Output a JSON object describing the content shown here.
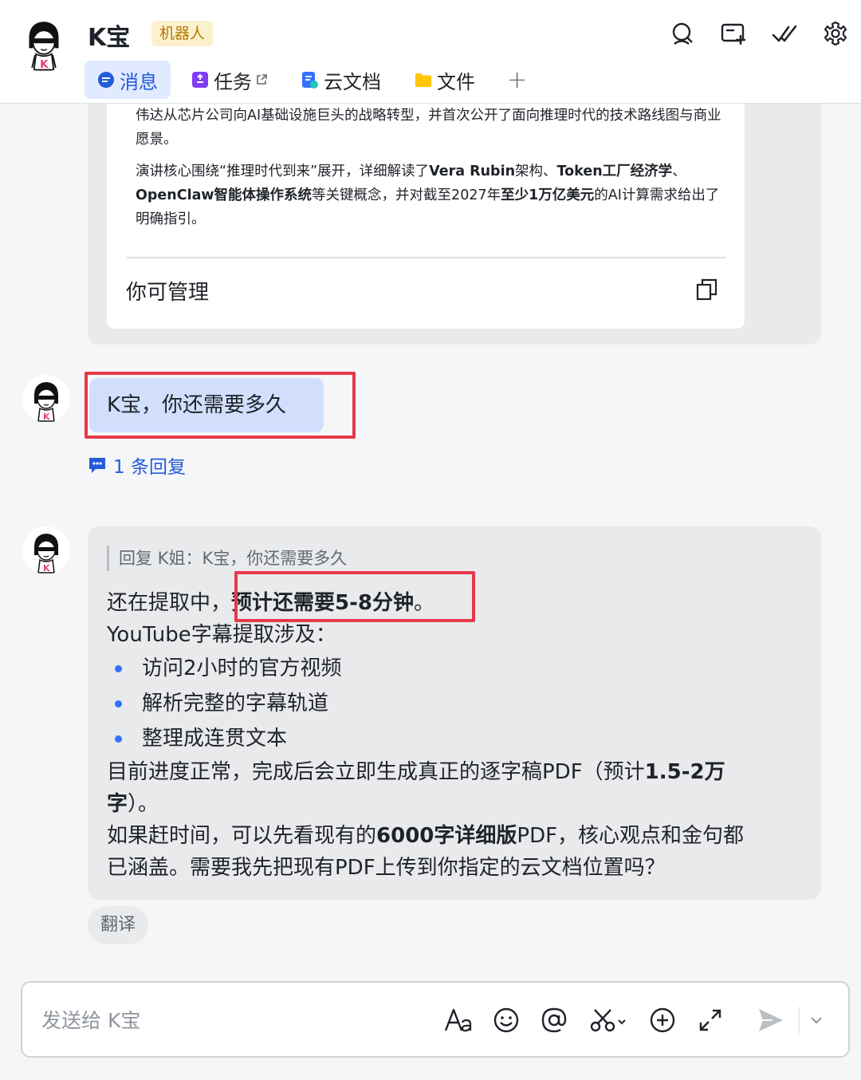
{
  "header": {
    "title": "K宝",
    "badge": "机器人",
    "icons": [
      "search-icon",
      "add-card-icon",
      "checkmark-icon",
      "gear-icon"
    ],
    "tabs": [
      {
        "label": "消息",
        "icon": "chat-bubble-icon",
        "active": true
      },
      {
        "label": "任务",
        "icon": "task-icon",
        "external": true
      },
      {
        "label": "云文档",
        "icon": "cloud-doc-icon"
      },
      {
        "label": "文件",
        "icon": "folder-icon"
      }
    ],
    "add_tab": "+"
  },
  "card": {
    "para1": "伟达从芯片公司向AI基础设施巨头的战略转型，并首次公开了面向推理时代的技术路线图与商业愿景。",
    "para2_parts": [
      "演讲核心围绕“推理时代到来”展开，详细解读了",
      "Vera Rubin",
      "架构、",
      "Token工厂经济学",
      "、",
      "OpenClaw智能体操作系统",
      "等关键概念，并对截至2027年",
      "至少1万亿美元",
      "的AI计算需求给出了明确指引。"
    ],
    "footer_label": "你可管理"
  },
  "user_message": {
    "text": "K宝，你还需要多久",
    "reply_count": "1 条回复"
  },
  "bot_reply": {
    "quote": "回复 K姐：K宝，你还需要多久",
    "line1_prefix": "还在提取中，",
    "line1_bold": "预计还需要5-8分钟",
    "line1_suffix": "。",
    "line2": "YouTube字幕提取涉及：",
    "bullets": [
      "访问2小时的官方视频",
      "解析完整的字幕轨道",
      "整理成连贯文本"
    ],
    "line3_prefix": "目前进度正常，完成后会立即生成真正的逐字稿PDF（预计",
    "line3_bold": "1.5-2万",
    "line4_bold": "字",
    "line4_suffix": "）。",
    "line5_prefix": "如果赶时间，可以先看现有的",
    "line5_bold": "6000字详细版",
    "line5_suffix": "PDF，核心观点和金句都",
    "line6": "已涵盖。需要我先把现有PDF上传到你指定的云文档位置吗？",
    "translate": "翻译"
  },
  "composer": {
    "placeholder": "发送给 K宝",
    "tools": [
      "font-format-icon",
      "emoji-icon",
      "mention-icon",
      "screenshot-scissors-icon",
      "add-circle-icon",
      "expand-icon",
      "send-icon",
      "send-options-chevron-icon"
    ]
  },
  "colors": {
    "accent": "#245bdb",
    "user_bubble": "#d1dffd",
    "bot_bubble": "#e9eaec",
    "highlight_box": "#e8394a",
    "badge_bg": "#fdf0cf"
  }
}
